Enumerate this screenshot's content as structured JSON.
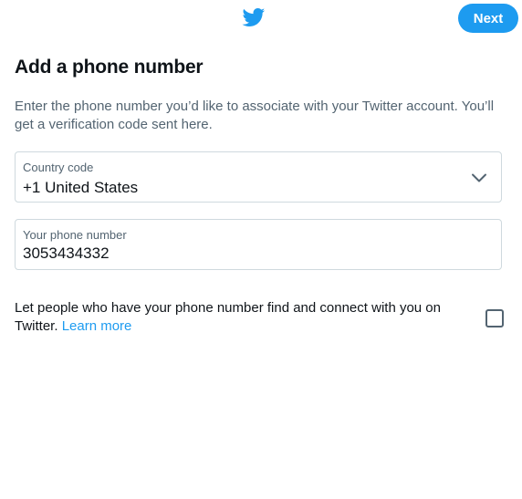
{
  "header": {
    "logo_icon": "twitter-bird-icon",
    "next_label": "Next"
  },
  "colors": {
    "brand": "#1d9bf0",
    "text": "#0f1419",
    "secondary_text": "#536471",
    "border": "#cfd9de"
  },
  "page": {
    "title": "Add a phone number",
    "description": "Enter the phone number you’d like to associate with your Twitter account. You’ll get a verification code sent here."
  },
  "country": {
    "label": "Country code",
    "value": "+1 United States",
    "icon": "chevron-down-icon"
  },
  "phone": {
    "label": "Your phone number",
    "value": "3053434332"
  },
  "discoverability": {
    "text": "Let people who have your phone number find and connect with you on Twitter.",
    "learn_more": "Learn more",
    "checked": false
  }
}
